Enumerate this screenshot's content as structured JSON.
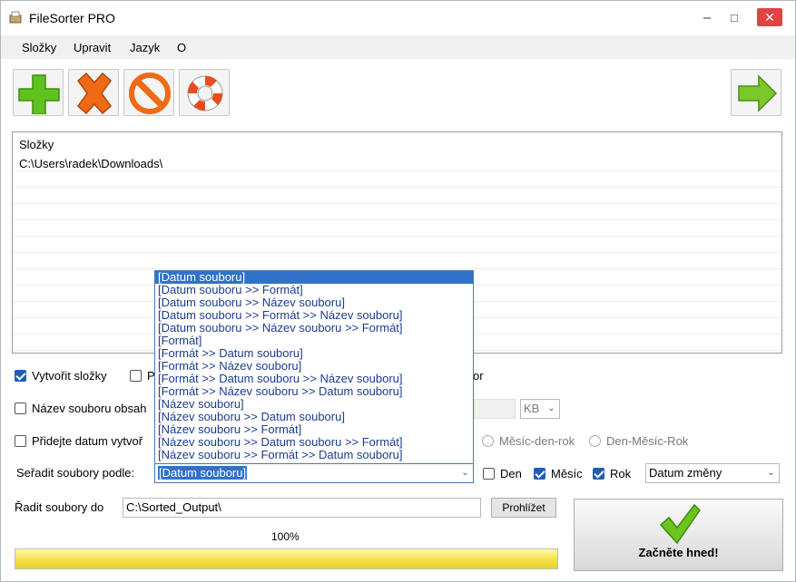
{
  "window": {
    "title": "FileSorter PRO",
    "minimize": "–",
    "maximize": "□",
    "close": "✕"
  },
  "menu": [
    "Složky",
    "Upravit",
    "Jazyk",
    "O"
  ],
  "toolbar": {
    "icons": [
      "add-folder-icon",
      "remove-icon",
      "block-icon",
      "help-lifebuoy-icon",
      "next-arrow-icon"
    ],
    "colors": {
      "green": "#5fc21e",
      "orange": "#ee6a14",
      "lifebuoy": "#e94c1d"
    }
  },
  "folders": {
    "header": "Složky",
    "items": [
      "C:\\Users\\radek\\Downloads\\"
    ]
  },
  "options": {
    "create_folders": "Vytvořit složky",
    "create_folders_checked": true,
    "partial_1": "P",
    "partial_or": "or",
    "filename_contains": "Název souboru obsah",
    "size_unit": "KB",
    "add_date": "Přidejte datum vytvoř",
    "date_fmt_1": "Měsíc-den-rok",
    "date_fmt_2": "Den-Měsíc-Rok",
    "sort_by_label": "Seřadit soubory podle:",
    "sort_by_value": "[Datum souboru]",
    "den": "Den",
    "den_checked": false,
    "mesic": "Měsíc",
    "mesic_checked": true,
    "rok": "Rok",
    "rok_checked": true,
    "date_type": "Datum změny"
  },
  "dropdown": {
    "selected_index": 0,
    "items": [
      "[Datum souboru]",
      "[Datum souboru >> Formát]",
      "[Datum souboru >> Název souboru]",
      "[Datum souboru >> Formát >> Název souboru]",
      "[Datum souboru >> Název souboru >> Formát]",
      "[Formát]",
      "[Formát >> Datum souboru]",
      "[Formát >> Název souboru]",
      "[Formát >> Datum souboru >> Název souboru]",
      "[Formát >> Název souboru >> Datum souboru]",
      "[Název souboru]",
      "[Název souboru >> Datum souboru]",
      "[Název souboru >> Formát]",
      "[Název souboru >> Datum souboru >> Formát]",
      "[Název souboru >> Formát >> Datum souboru]"
    ]
  },
  "output": {
    "label": "Řadit soubory do",
    "path": "C:\\Sorted_Output\\",
    "browse": "Prohlížet"
  },
  "progress": {
    "label": "100%",
    "value": 1.0
  },
  "start_button": "Začněte hned!"
}
